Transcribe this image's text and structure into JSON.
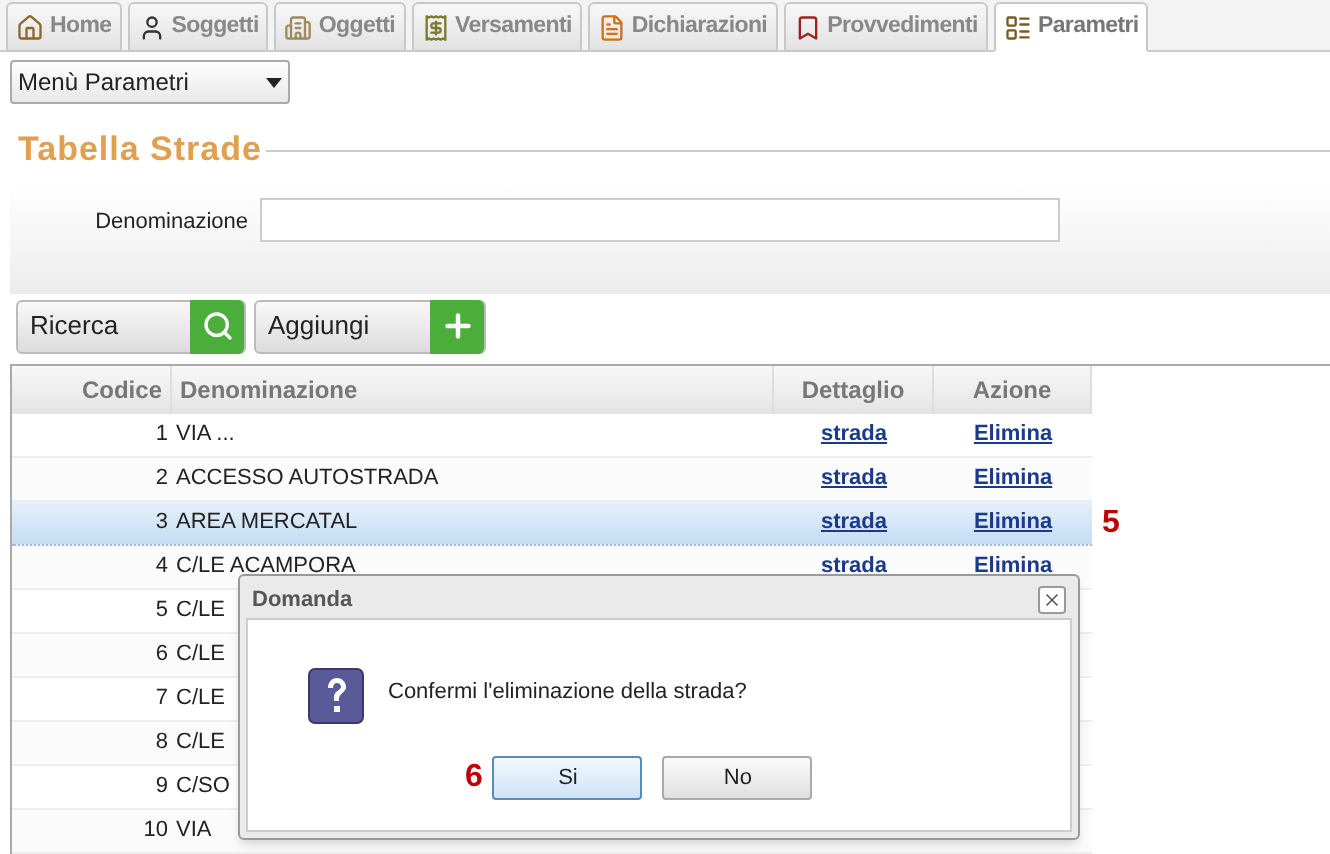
{
  "tabs": [
    {
      "label": "Home",
      "selected": false
    },
    {
      "label": "Soggetti",
      "selected": false
    },
    {
      "label": "Oggetti",
      "selected": false
    },
    {
      "label": "Versamenti",
      "selected": false
    },
    {
      "label": "Dichiarazioni",
      "selected": false
    },
    {
      "label": "Provvedimenti",
      "selected": false
    },
    {
      "label": "Parametri",
      "selected": true
    }
  ],
  "menu_select": {
    "value": "Menù Parametri"
  },
  "section_title": "Tabella Strade",
  "filter": {
    "label": "Denominazione"
  },
  "buttons": [
    {
      "label": "Ricerca",
      "kind": "search"
    },
    {
      "label": "Aggiungi",
      "kind": "add"
    }
  ],
  "table": {
    "columns": [
      "Codice",
      "Denominazione",
      "Dettaglio",
      "Azione"
    ],
    "rows": [
      {
        "code": "1",
        "name": "VIA ...",
        "detail": "strada",
        "action": "Elimina",
        "selected": false
      },
      {
        "code": "2",
        "name": "ACCESSO AUTOSTRADA",
        "detail": "strada",
        "action": "Elimina",
        "selected": false
      },
      {
        "code": "3",
        "name": "AREA MERCATAL",
        "detail": "strada",
        "action": "Elimina",
        "selected": true,
        "callout": "5"
      },
      {
        "code": "4",
        "name": "C/LE ACAMPORA",
        "detail": "strada",
        "action": "Elimina",
        "selected": false
      },
      {
        "code": "5",
        "name": "C/LE",
        "selected": false
      },
      {
        "code": "6",
        "name": "C/LE",
        "selected": false
      },
      {
        "code": "7",
        "name": "C/LE",
        "selected": false
      },
      {
        "code": "8",
        "name": "C/LE",
        "selected": false
      },
      {
        "code": "9",
        "name": "C/SO",
        "selected": false
      },
      {
        "code": "10",
        "name": "VIA",
        "selected": false
      }
    ]
  },
  "dialog": {
    "title": "Domanda",
    "message": "Confermi l'eliminazione della strada?",
    "buttons": [
      {
        "label": "Si",
        "selected": true,
        "callout": "6"
      },
      {
        "label": "No",
        "selected": false
      }
    ]
  }
}
